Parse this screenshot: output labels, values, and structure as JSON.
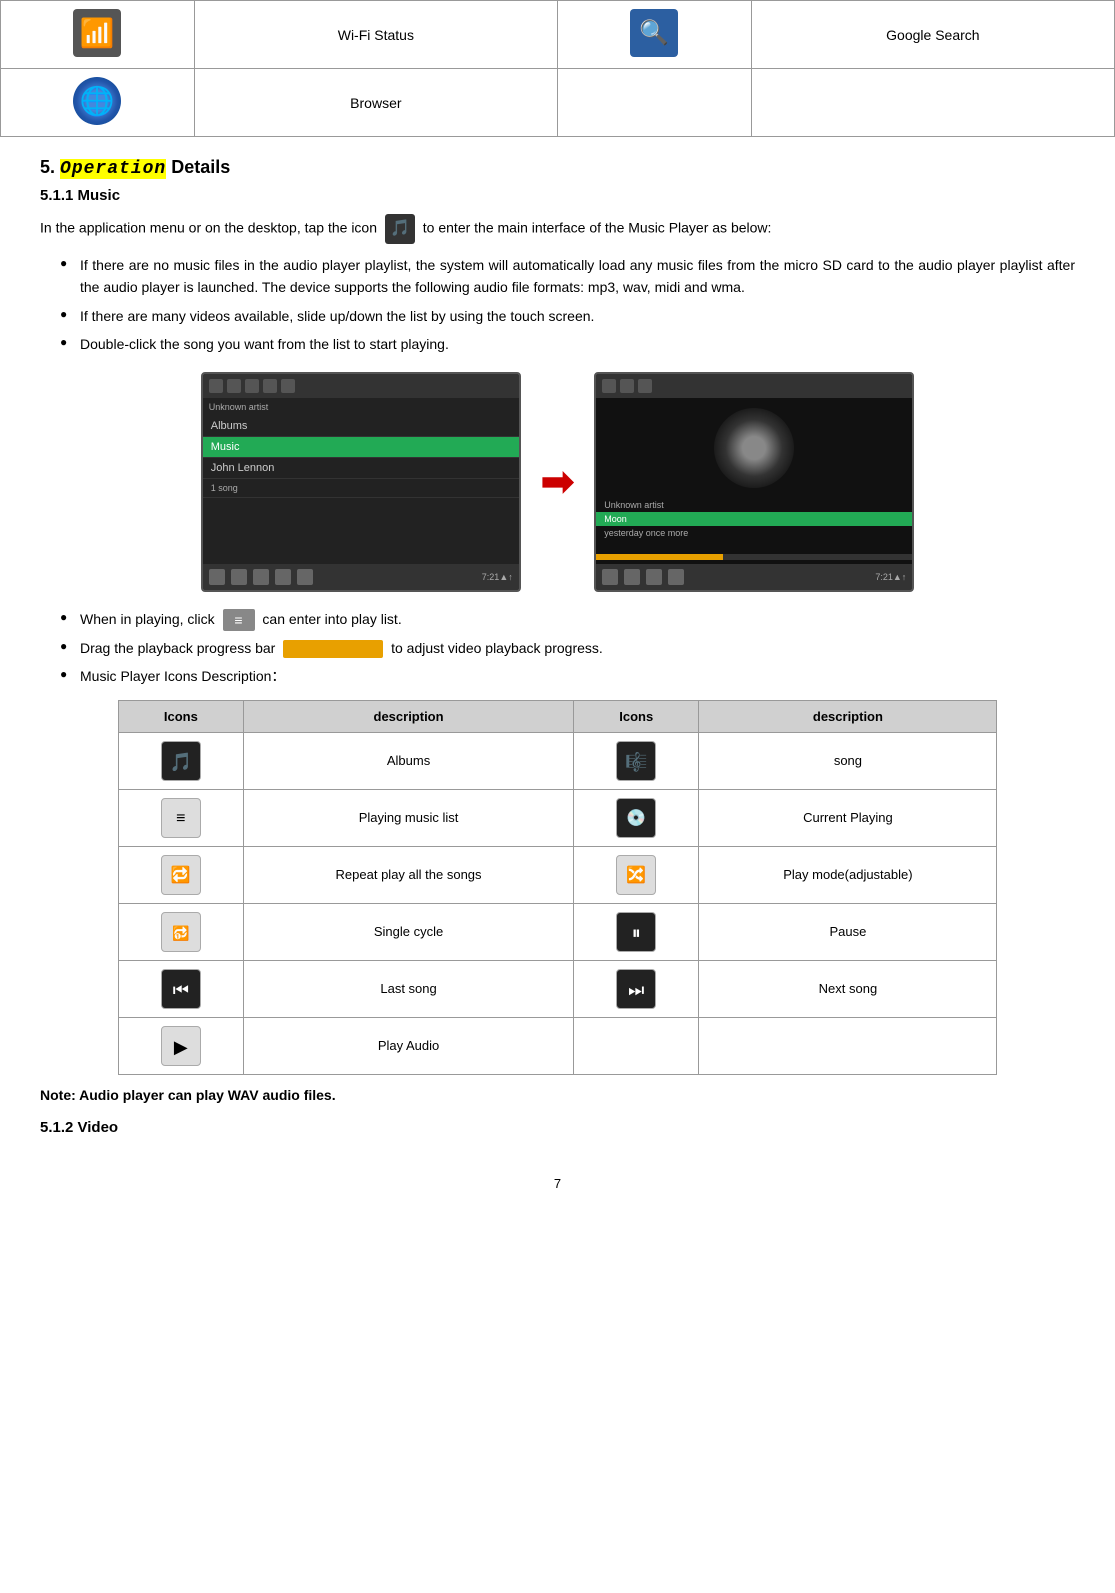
{
  "top_table": {
    "rows": [
      {
        "col1_icon": "wifi-icon",
        "col2_label": "Wi-Fi Status",
        "col3_icon": "google-search-icon",
        "col4_label": "Google Search"
      },
      {
        "col1_icon": "browser-icon",
        "col2_label": "Browser",
        "col3_icon": "",
        "col4_label": ""
      }
    ]
  },
  "section5": {
    "heading_prefix": "5. ",
    "heading_highlight": "Operation",
    "heading_suffix": " Details",
    "sub51_heading": "5.1.1 Music",
    "intro_paragraph": "In the application menu or on the desktop, tap the icon",
    "intro_paragraph_suffix": "to enter the main interface of the Music Player as below:",
    "bullet1": "If there are no music files in the audio player playlist, the system will automatically load any music files from the micro SD card to the audio player playlist after the audio player is launched. The device supports the following audio file formats: mp3, wav, midi and wma.",
    "bullet2": "If there are many videos available, slide up/down the list by using the touch screen.",
    "bullet3": "Double-click the song you want from the list to start playing.",
    "bullet4_prefix": "When in playing, click",
    "bullet4_suffix": "can enter into play list.",
    "bullet5_prefix": "Drag the playback progress bar",
    "bullet5_suffix": "to adjust video playback progress.",
    "bullet6": "Music Player Icons Description：",
    "icons_table": {
      "headers": [
        "Icons",
        "description",
        "Icons",
        "description"
      ],
      "rows": [
        {
          "icon1": "albums-icon",
          "desc1": "Albums",
          "icon2": "song-icon",
          "desc2": "song"
        },
        {
          "icon1": "playlist-icon",
          "desc1": "Playing music list",
          "icon2": "current-playing-icon",
          "desc2": "Current Playing"
        },
        {
          "icon1": "repeat-all-icon",
          "desc1": "Repeat play all the songs",
          "icon2": "play-mode-icon",
          "desc2": "Play mode(adjustable)"
        },
        {
          "icon1": "single-cycle-icon",
          "desc1": "Single cycle",
          "icon2": "pause-icon",
          "desc2": "Pause"
        },
        {
          "icon1": "last-song-icon",
          "desc1": "Last song",
          "icon2": "next-song-icon",
          "desc2": "Next song"
        },
        {
          "icon1": "play-audio-icon",
          "desc1": "Play Audio",
          "icon2": "",
          "desc2": ""
        }
      ]
    },
    "note": "Note: Audio player can play WAV audio files.",
    "sub52_heading": "5.1.2 Video"
  },
  "page_number": "7"
}
